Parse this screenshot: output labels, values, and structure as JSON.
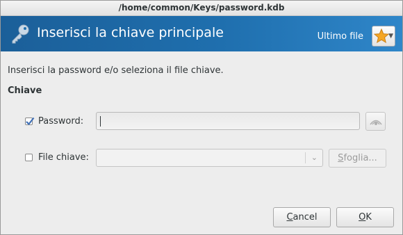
{
  "window": {
    "title": "/home/common/Keys/password.kdb"
  },
  "banner": {
    "heading": "Inserisci la chiave principale",
    "recent_label": "Ultimo file",
    "icon": "key-icon",
    "recent_icon": "star-icon"
  },
  "intro": "Inserisci la password e/o seleziona il file chiave.",
  "section": "Chiave",
  "password": {
    "label": "Password:",
    "checked": true,
    "value": "",
    "toggle_icon": "eye-icon"
  },
  "keyfile": {
    "label": "File chiave:",
    "checked": false,
    "value": "",
    "browse_first": "S",
    "browse_rest": "foglia..."
  },
  "buttons": {
    "cancel_first": "C",
    "cancel_rest": "ancel",
    "ok_first": "O",
    "ok_rest": "K"
  },
  "colors": {
    "banner_start": "#1b5f99",
    "banner_end": "#2f86c9",
    "check": "#3f6fb5",
    "star": "#f5a623"
  }
}
